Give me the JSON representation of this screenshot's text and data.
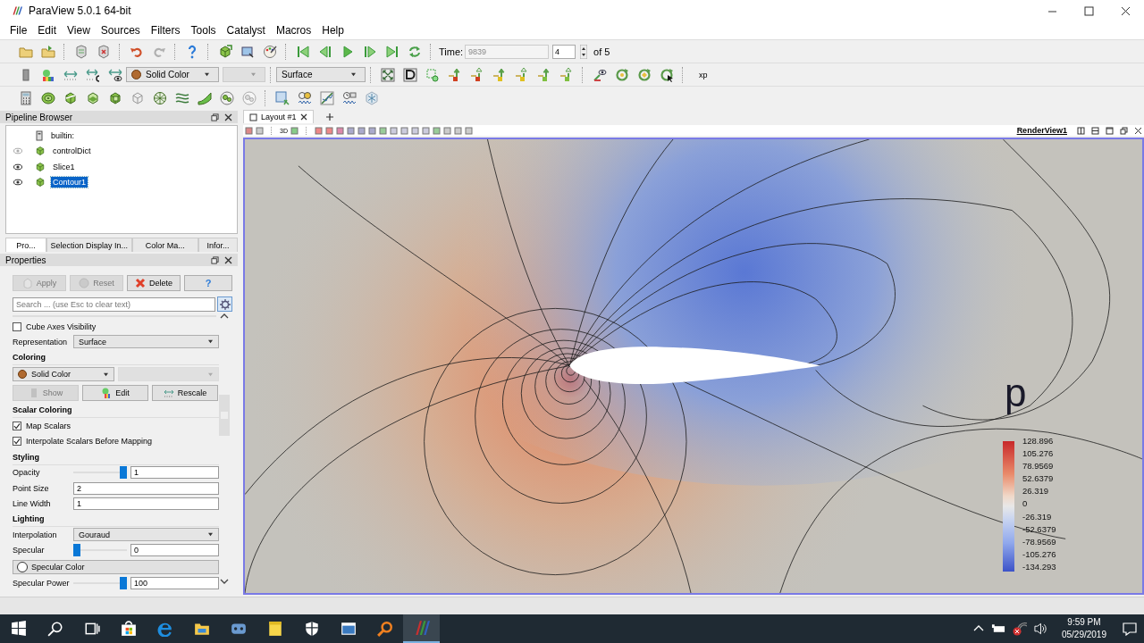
{
  "window": {
    "title": "ParaView 5.0.1 64-bit"
  },
  "menu": [
    "File",
    "Edit",
    "View",
    "Sources",
    "Filters",
    "Tools",
    "Catalyst",
    "Macros",
    "Help"
  ],
  "toolbar": {
    "time_label": "Time:",
    "time_value": "9839",
    "timestep": "4",
    "timestep_total": "of 5",
    "coloring": "Solid Color",
    "representation": "Surface",
    "macro": "xp"
  },
  "pipeline_browser": {
    "title": "Pipeline Browser",
    "items": [
      {
        "label": "builtin:",
        "kind": "server",
        "selected": false
      },
      {
        "label": "controlDict",
        "kind": "source",
        "visible": false,
        "selected": false
      },
      {
        "label": "Slice1",
        "kind": "source",
        "visible": true,
        "selected": false
      },
      {
        "label": "Contour1",
        "kind": "source",
        "visible": true,
        "selected": true
      }
    ]
  },
  "panel_tabs": [
    {
      "label": "Pro...",
      "selected": true
    },
    {
      "label": "Selection Display In...",
      "selected": false
    },
    {
      "label": "Color Ma...",
      "selected": false
    },
    {
      "label": "Infor...",
      "selected": false
    }
  ],
  "properties": {
    "title": "Properties",
    "buttons": [
      {
        "label": "Apply",
        "kind": "apply",
        "disabled": true
      },
      {
        "label": "Reset",
        "kind": "reset",
        "disabled": true
      },
      {
        "label": "Delete",
        "kind": "delete",
        "disabled": false
      },
      {
        "label": "?",
        "kind": "help",
        "disabled": false
      }
    ],
    "search_placeholder": "Search ... (use Esc to clear text)",
    "rows": [
      {
        "kind": "checkbox",
        "label": "Cube Axes Visibility",
        "checked": false
      },
      {
        "kind": "dropdown",
        "label": "Representation",
        "value": "Surface"
      },
      {
        "kind": "section",
        "label": "Coloring"
      },
      {
        "kind": "coloring",
        "value": "Solid Color"
      },
      {
        "kind": "buttons",
        "buttons": [
          {
            "label": "Show",
            "kind": "show",
            "disabled": true
          },
          {
            "label": "Edit",
            "kind": "edit",
            "disabled": false
          },
          {
            "label": "Rescale",
            "kind": "rescale",
            "disabled": false
          }
        ]
      },
      {
        "kind": "section",
        "label": "Scalar Coloring"
      },
      {
        "kind": "checkbox",
        "label": "Map Scalars",
        "checked": true
      },
      {
        "kind": "checkbox",
        "label": "Interpolate Scalars Before Mapping",
        "checked": true
      },
      {
        "kind": "section",
        "label": "Styling"
      },
      {
        "kind": "slider",
        "label": "Opacity",
        "level": 1,
        "value": "1"
      },
      {
        "kind": "field",
        "label": "Point Size",
        "value": "2"
      },
      {
        "kind": "field",
        "label": "Line Width",
        "value": "1"
      },
      {
        "kind": "section",
        "label": "Lighting"
      },
      {
        "kind": "dropdown",
        "label": "Interpolation",
        "value": "Gouraud"
      },
      {
        "kind": "slider",
        "label": "Specular",
        "level": 0,
        "value": "0"
      },
      {
        "kind": "color_button",
        "label": "Specular Color"
      },
      {
        "kind": "slider",
        "label": "Specular Power",
        "level": 1,
        "value": "100"
      }
    ]
  },
  "layout_tabs": [
    {
      "label": "Layout #1",
      "selected": true
    }
  ],
  "view": {
    "toolbar_text": "3D",
    "name": "RenderView1",
    "legend": {
      "title": "p",
      "labels": [
        "128.896",
        "105.276",
        "78.9569",
        "52.6379",
        "26.319",
        "0",
        "-26.319",
        "-52.6379",
        "-78.9569",
        "-105.276",
        "-134.293"
      ]
    }
  },
  "taskbar": {
    "time": "9:59 PM",
    "date": "05/29/2019"
  }
}
